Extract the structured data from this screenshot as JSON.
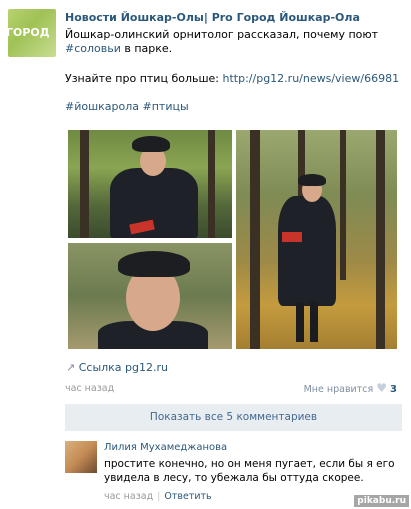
{
  "post": {
    "group_name": "Новости Йошкар-Олы| Pro Город Йошкар-Ола",
    "avatar_text": "ГОРОД",
    "line1": "Йошкар-олинский орнитолог рассказал, почему поют",
    "line2_tag": "#соловьи",
    "line2_rest": " в парке.",
    "more_label": "Узнайте про птиц больше: ",
    "more_url": "http://pg12.ru/news/view/66981",
    "tags": "#йошкарола #птицы",
    "link_label": "Ссылка pg12.ru",
    "time": "час назад",
    "likes_label": "Мне нравится",
    "likes_count": "3",
    "show_comments": "Показать все 5 комментариев"
  },
  "comment": {
    "author": "Лилия Мухамеджанова",
    "text": "простите конечно, но он меня пугает, если бы я его увидела в лесу, то убежала бы оттуда скорее.",
    "time": "час назад",
    "reply": "Ответить"
  },
  "watermark": "pikabu.ru",
  "icons": {
    "link": "share-arrow-icon",
    "like": "heart-icon"
  }
}
